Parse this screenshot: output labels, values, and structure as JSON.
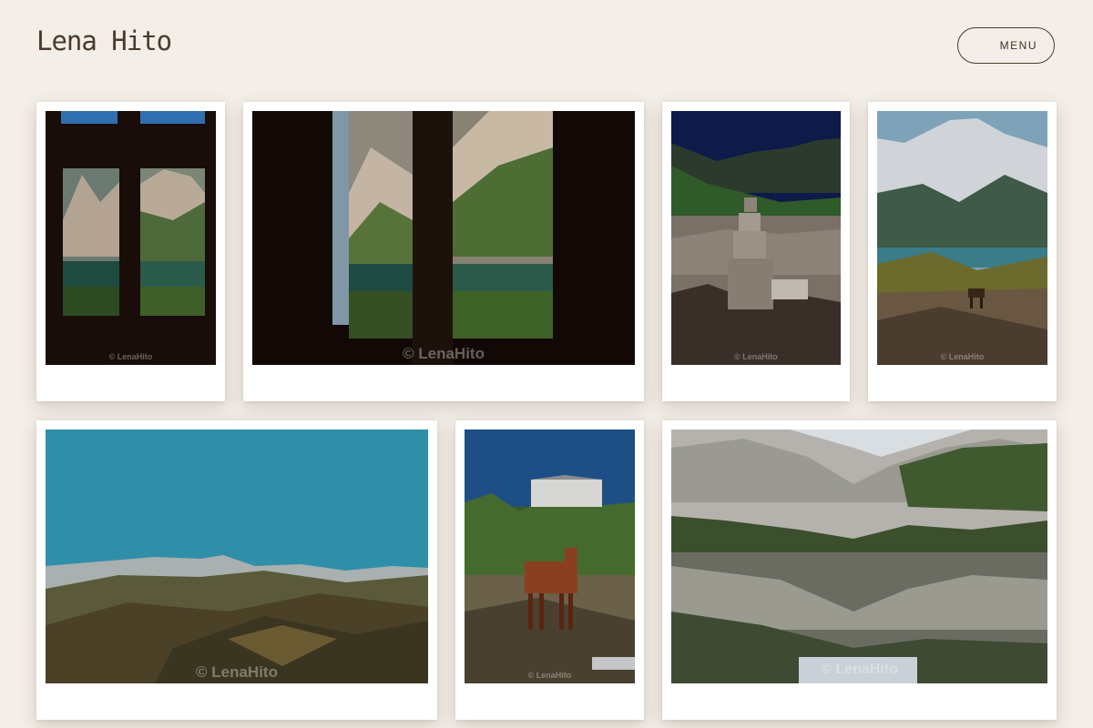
{
  "header": {
    "brand": "Lena Hito",
    "menu_label": "MENU"
  },
  "gallery": {
    "photos": [
      {
        "subject": "window view of mountain lake",
        "credit": "© LenaHito"
      },
      {
        "subject": "window view of mountain lake wide",
        "credit": "© LenaHito"
      },
      {
        "subject": "stone cairn under mountains",
        "credit": "© LenaHito"
      },
      {
        "subject": "horse grazing by mountain lake",
        "credit": "© LenaHito"
      },
      {
        "subject": "mountain range under teal sky",
        "credit": "© LenaHito"
      },
      {
        "subject": "horse in front of mountain hut",
        "credit": "© LenaHito"
      },
      {
        "subject": "mountain lake reflection",
        "credit": "© LenaHito"
      }
    ]
  }
}
